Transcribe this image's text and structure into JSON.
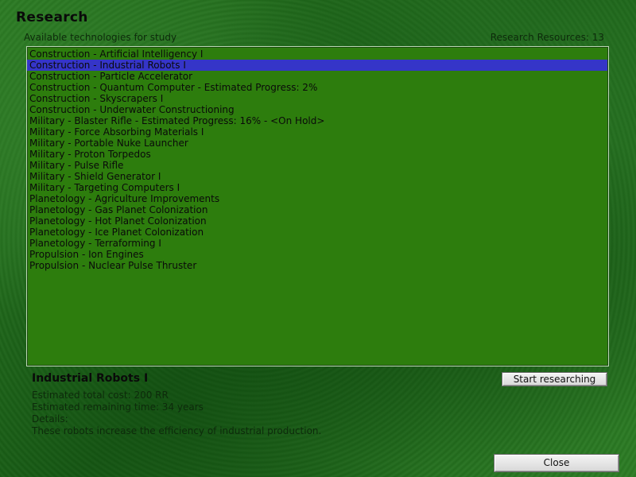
{
  "header": {
    "title": "Research",
    "available_label": "Available technologies for study",
    "resources_label": "Research Resources: 13"
  },
  "technologies": [
    {
      "label": "Construction - Artificial Intelligency I",
      "selected": false
    },
    {
      "label": "Construction - Industrial Robots I",
      "selected": true
    },
    {
      "label": "Construction - Particle Accelerator",
      "selected": false
    },
    {
      "label": "Construction - Quantum Computer - Estimated Progress: 2%",
      "selected": false
    },
    {
      "label": "Construction - Skyscrapers I",
      "selected": false
    },
    {
      "label": "Construction - Underwater Constructioning",
      "selected": false
    },
    {
      "label": "Military - Blaster Rifle - Estimated Progress: 16% - <On Hold>",
      "selected": false
    },
    {
      "label": "Military - Force Absorbing Materials I",
      "selected": false
    },
    {
      "label": "Military - Portable Nuke Launcher",
      "selected": false
    },
    {
      "label": "Military - Proton Torpedos",
      "selected": false
    },
    {
      "label": "Military - Pulse Rifle",
      "selected": false
    },
    {
      "label": "Military - Shield Generator I",
      "selected": false
    },
    {
      "label": "Military - Targeting Computers I",
      "selected": false
    },
    {
      "label": "Planetology - Agriculture Improvements",
      "selected": false
    },
    {
      "label": "Planetology - Gas Planet Colonization",
      "selected": false
    },
    {
      "label": "Planetology - Hot Planet Colonization",
      "selected": false
    },
    {
      "label": "Planetology - Ice Planet Colonization",
      "selected": false
    },
    {
      "label": "Planetology - Terraforming I",
      "selected": false
    },
    {
      "label": "Propulsion - Ion Engines",
      "selected": false
    },
    {
      "label": "Propulsion - Nuclear Pulse Thruster",
      "selected": false
    }
  ],
  "details": {
    "name": "Industrial Robots I",
    "cost": "Estimated total cost: 200 RR",
    "time": "Estimated remaining time: 34 years",
    "details_label": "Details:",
    "description": "These robots increase the efficiency of industrial production."
  },
  "buttons": {
    "start_label": "Start researching",
    "close_label": "Close"
  },
  "colors": {
    "list_background": "#2d7d0d",
    "selection": "#3535c8"
  }
}
